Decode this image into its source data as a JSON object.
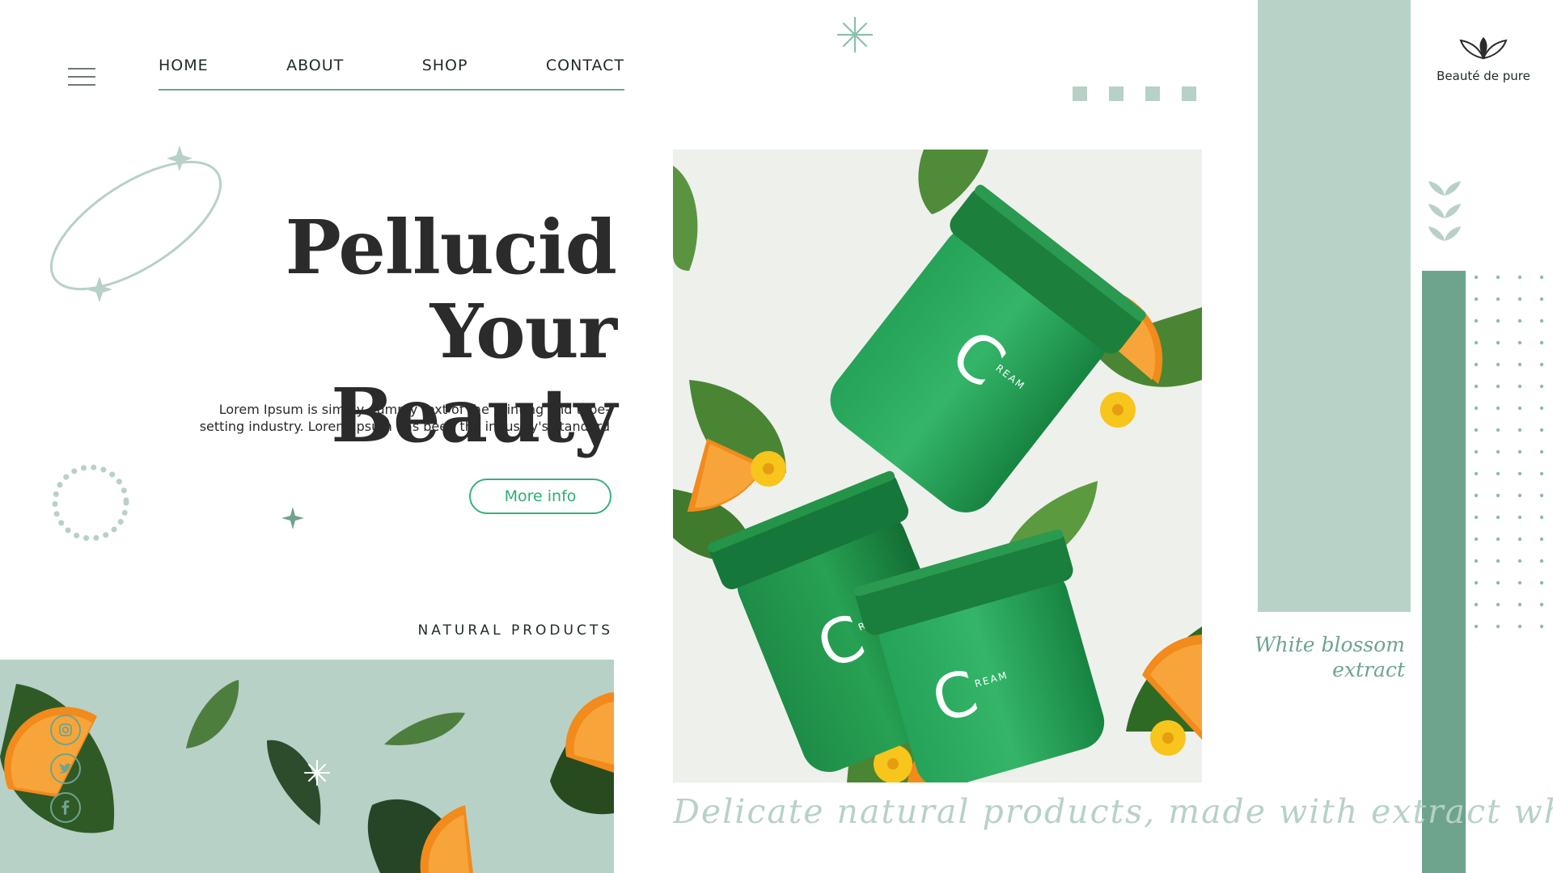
{
  "nav": {
    "items": [
      {
        "label": "HOME"
      },
      {
        "label": "ABOUT"
      },
      {
        "label": "SHOP"
      },
      {
        "label": "CONTACT"
      }
    ]
  },
  "brand": {
    "name": "Beauté de pure"
  },
  "hero": {
    "title_line1": "Pellucid",
    "title_line2": "Your Beauty",
    "description_line1": "Lorem Ipsum is simply dummy text of the printing and type-",
    "description_line2": "setting industry. Lorem Ipsum has been the industry's standard",
    "cta_label": "More info"
  },
  "section": {
    "label": "NATURAL PRODUCTS"
  },
  "side": {
    "blossom_line1": "White blossom",
    "blossom_line2": "extract"
  },
  "tagline": "Delicate natural products, made with extract white flow",
  "product": {
    "jar_letter": "C",
    "jar_brand": "REAM"
  },
  "social": [
    {
      "icon": "instagram-icon"
    },
    {
      "icon": "twitter-icon"
    },
    {
      "icon": "facebook-icon"
    }
  ],
  "colors": {
    "mint": "#b7d1c7",
    "sage": "#6ea48e",
    "button_green": "#35b27a",
    "text_dark": "#2b2b2b",
    "jar_green": "#1f9a52",
    "orange": "#f28a1c",
    "leaf": "#4e8a3a"
  }
}
